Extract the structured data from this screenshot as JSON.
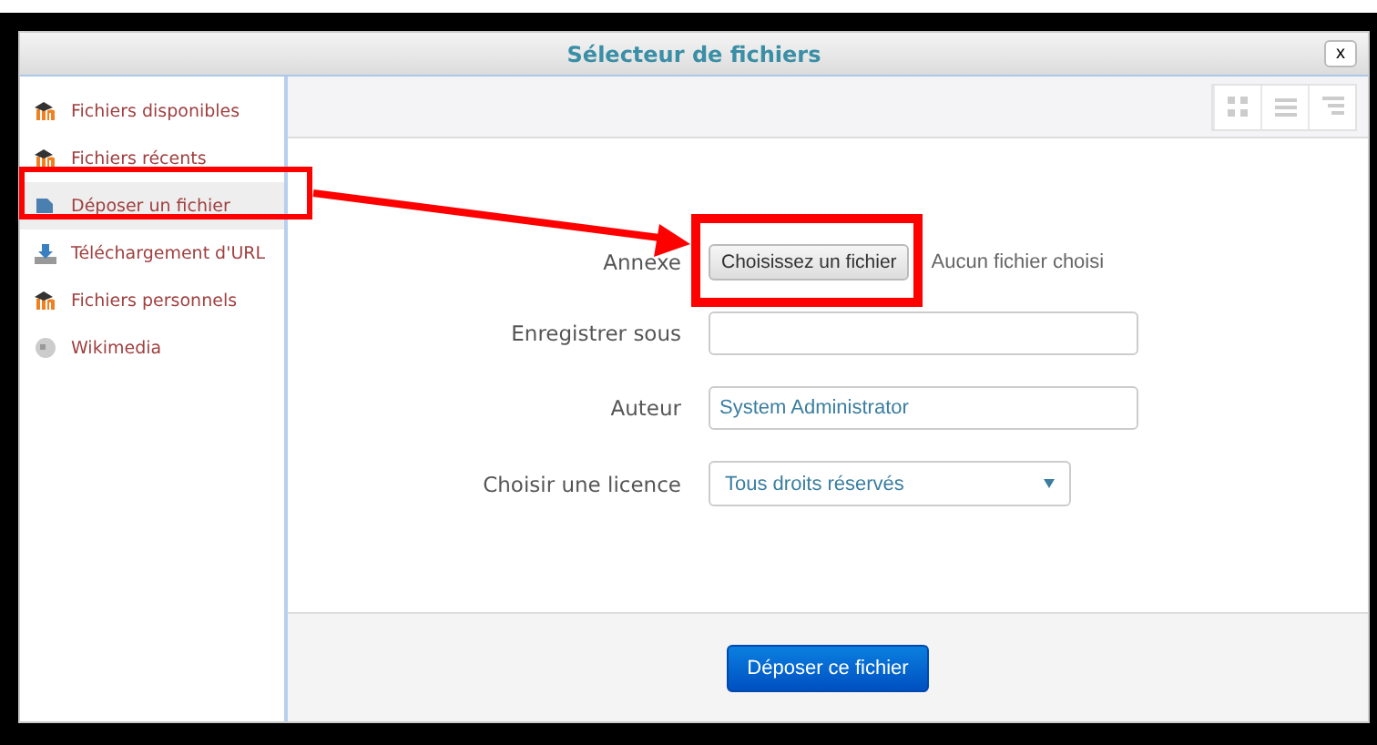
{
  "window": {
    "title": "Sélecteur de fichiers",
    "close": "x"
  },
  "sidebar": {
    "items": [
      {
        "label": "Fichiers disponibles",
        "kind": "moodle",
        "selected": false
      },
      {
        "label": "Fichiers récents",
        "kind": "moodle",
        "selected": false
      },
      {
        "label": "Déposer un fichier",
        "kind": "upload",
        "selected": true
      },
      {
        "label": "Téléchargement d'URL",
        "kind": "download",
        "selected": false
      },
      {
        "label": "Fichiers personnels",
        "kind": "moodle",
        "selected": false
      },
      {
        "label": "Wikimedia",
        "kind": "globe",
        "selected": false
      }
    ]
  },
  "form": {
    "attachment": {
      "label": "Annexe",
      "button": "Choisissez un fichier",
      "status": "Aucun fichier choisi"
    },
    "save_as": {
      "label": "Enregistrer sous"
    },
    "author": {
      "label": "Auteur",
      "value": "System Administrator"
    },
    "license": {
      "label": "Choisir une licence",
      "value": "Tous droits réservés"
    }
  },
  "footer": {
    "button": "Déposer ce fichier"
  }
}
